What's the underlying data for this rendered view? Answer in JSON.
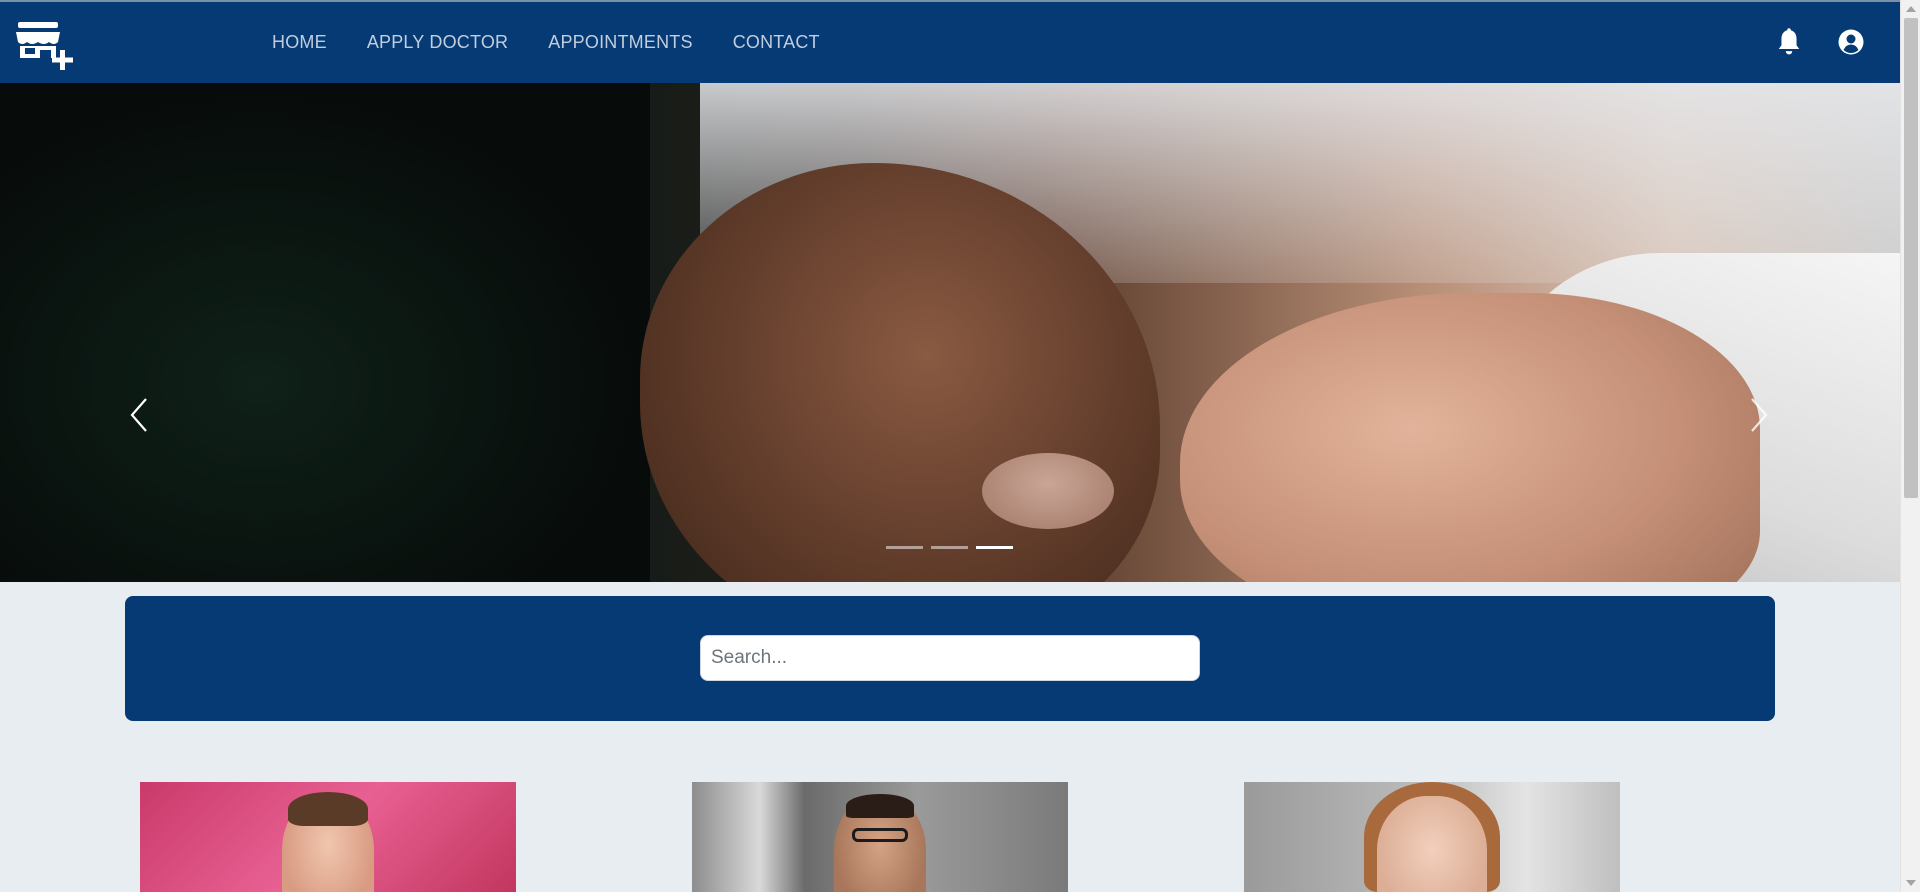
{
  "nav": {
    "logo_icon": "clinic-plus-icon",
    "links": [
      {
        "label": "HOME"
      },
      {
        "label": "APPLY DOCTOR"
      },
      {
        "label": "APPOINTMENTS"
      },
      {
        "label": "CONTACT"
      }
    ],
    "icons": [
      "bell-icon",
      "user-circle-icon"
    ],
    "background_color": "#053a74",
    "link_color": "#c2cede"
  },
  "carousel": {
    "slide_count": 3,
    "active_index": 2,
    "prev_icon": "chevron-left-icon",
    "next_icon": "chevron-right-icon"
  },
  "search": {
    "placeholder": "Search...",
    "value": ""
  },
  "doctors": [
    {
      "photo": "doctor-photo-1"
    },
    {
      "photo": "doctor-photo-2"
    },
    {
      "photo": "doctor-photo-3"
    }
  ],
  "colors": {
    "page_background": "#e8edf2",
    "panel_background": "#053a74"
  }
}
